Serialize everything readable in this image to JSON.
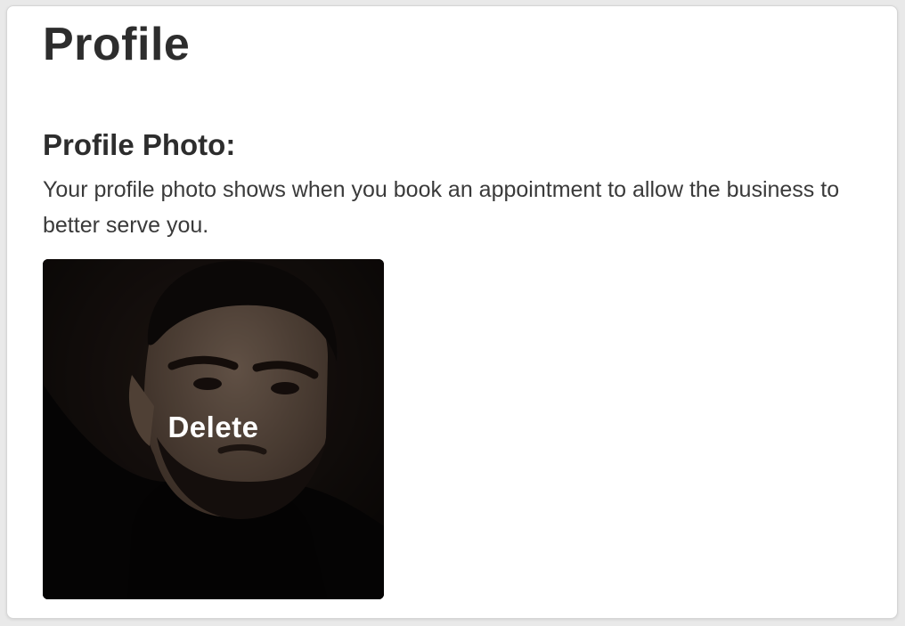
{
  "page": {
    "title": "Profile"
  },
  "profile_photo": {
    "heading": "Profile Photo:",
    "description": "Your profile photo shows when you book an appointment to allow the business to better serve you.",
    "delete_label": "Delete",
    "photo_icon": "user-portrait-photo"
  },
  "colors": {
    "text_primary": "#2d2d2d",
    "card_background": "#ffffff",
    "page_background": "#e9e9e9"
  }
}
